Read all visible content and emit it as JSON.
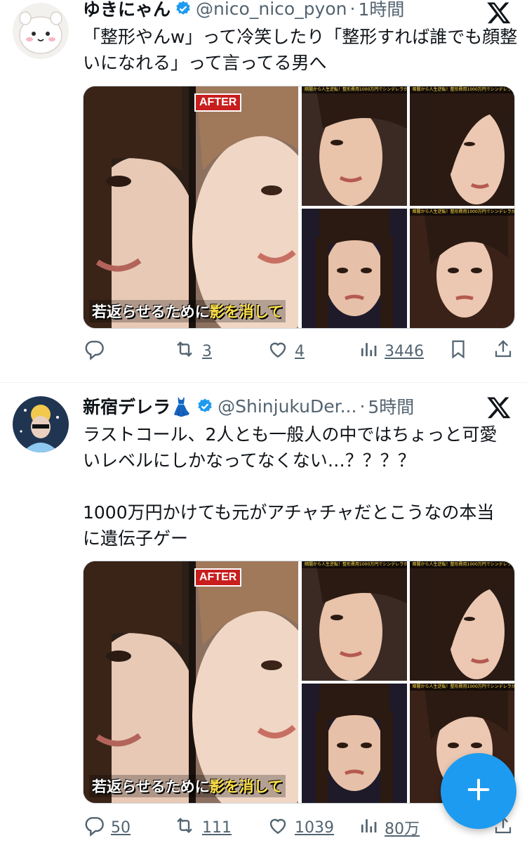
{
  "tweet1": {
    "name": "ゆきにゃん",
    "handle": "@nico_nico_pyon",
    "time": "1時間",
    "text": "「整形やんw」って冷笑したり「整形すれば誰でも顔整いになれる」って言ってる男へ",
    "media": {
      "after_label": "AFTER",
      "caption_prefix": "若返らせるために",
      "caption_highlight": "影を消して",
      "banner_text": "暗闇から人生逆転！整形費用1000万円でシンデレラが"
    },
    "actions": {
      "replies": "",
      "retweets": "3",
      "likes": "4",
      "views": "3446"
    }
  },
  "tweet2": {
    "name": "新宿デレラ👗",
    "handle": "@ShinjukuDer...",
    "time": "5時間",
    "text": "ラストコール、2人とも一般人の中ではちょっと可愛いレベルにしかなってなくない…？？？？\n\n1000万円かけても元がアチャチャだとこうなの本当に遺伝子ゲー",
    "media": {
      "after_label": "AFTER",
      "caption_prefix": "若返らせるために",
      "caption_highlight": "影を消して",
      "banner_text": "暗闇から人生逆転！整形費用1000万円でシンデレラが"
    },
    "actions": {
      "replies": "50",
      "retweets": "111",
      "likes": "1039",
      "views": "80万"
    }
  },
  "colors": {
    "accent": "#1d9bf0",
    "text": "#0f1419",
    "muted": "#536471",
    "after_badge": "#c81e1e",
    "caption_highlight": "#ffe14a"
  },
  "icons": [
    "reply-icon",
    "retweet-icon",
    "like-icon",
    "views-icon",
    "bookmark-icon",
    "share-icon",
    "x-logo-icon",
    "verified-icon",
    "compose-plus-icon"
  ]
}
